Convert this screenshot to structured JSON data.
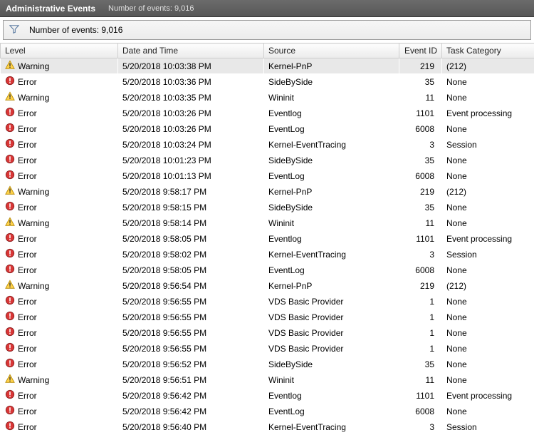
{
  "titlebar": {
    "title": "Administrative Events",
    "subtitle": "Number of events: 9,016"
  },
  "filterbar": {
    "count_label": "Number of events: 9,016"
  },
  "columns": {
    "level": "Level",
    "datetime": "Date and Time",
    "source": "Source",
    "event_id": "Event ID",
    "task_category": "Task Category"
  },
  "events": [
    {
      "level": "Warning",
      "icon": "warning",
      "datetime": "5/20/2018 10:03:38 PM",
      "source": "Kernel-PnP",
      "event_id": 219,
      "task_category": "(212)",
      "selected": true
    },
    {
      "level": "Error",
      "icon": "error",
      "datetime": "5/20/2018 10:03:36 PM",
      "source": "SideBySide",
      "event_id": 35,
      "task_category": "None"
    },
    {
      "level": "Warning",
      "icon": "warning",
      "datetime": "5/20/2018 10:03:35 PM",
      "source": "Wininit",
      "event_id": 11,
      "task_category": "None"
    },
    {
      "level": "Error",
      "icon": "error",
      "datetime": "5/20/2018 10:03:26 PM",
      "source": "Eventlog",
      "event_id": 1101,
      "task_category": "Event processing"
    },
    {
      "level": "Error",
      "icon": "error",
      "datetime": "5/20/2018 10:03:26 PM",
      "source": "EventLog",
      "event_id": 6008,
      "task_category": "None"
    },
    {
      "level": "Error",
      "icon": "error",
      "datetime": "5/20/2018 10:03:24 PM",
      "source": "Kernel-EventTracing",
      "event_id": 3,
      "task_category": "Session"
    },
    {
      "level": "Error",
      "icon": "error",
      "datetime": "5/20/2018 10:01:23 PM",
      "source": "SideBySide",
      "event_id": 35,
      "task_category": "None"
    },
    {
      "level": "Error",
      "icon": "error",
      "datetime": "5/20/2018 10:01:13 PM",
      "source": "EventLog",
      "event_id": 6008,
      "task_category": "None"
    },
    {
      "level": "Warning",
      "icon": "warning",
      "datetime": "5/20/2018 9:58:17 PM",
      "source": "Kernel-PnP",
      "event_id": 219,
      "task_category": "(212)"
    },
    {
      "level": "Error",
      "icon": "error",
      "datetime": "5/20/2018 9:58:15 PM",
      "source": "SideBySide",
      "event_id": 35,
      "task_category": "None"
    },
    {
      "level": "Warning",
      "icon": "warning",
      "datetime": "5/20/2018 9:58:14 PM",
      "source": "Wininit",
      "event_id": 11,
      "task_category": "None"
    },
    {
      "level": "Error",
      "icon": "error",
      "datetime": "5/20/2018 9:58:05 PM",
      "source": "Eventlog",
      "event_id": 1101,
      "task_category": "Event processing"
    },
    {
      "level": "Error",
      "icon": "error",
      "datetime": "5/20/2018 9:58:02 PM",
      "source": "Kernel-EventTracing",
      "event_id": 3,
      "task_category": "Session"
    },
    {
      "level": "Error",
      "icon": "error",
      "datetime": "5/20/2018 9:58:05 PM",
      "source": "EventLog",
      "event_id": 6008,
      "task_category": "None"
    },
    {
      "level": "Warning",
      "icon": "warning",
      "datetime": "5/20/2018 9:56:54 PM",
      "source": "Kernel-PnP",
      "event_id": 219,
      "task_category": "(212)"
    },
    {
      "level": "Error",
      "icon": "error",
      "datetime": "5/20/2018 9:56:55 PM",
      "source": "VDS Basic Provider",
      "event_id": 1,
      "task_category": "None"
    },
    {
      "level": "Error",
      "icon": "error",
      "datetime": "5/20/2018 9:56:55 PM",
      "source": "VDS Basic Provider",
      "event_id": 1,
      "task_category": "None"
    },
    {
      "level": "Error",
      "icon": "error",
      "datetime": "5/20/2018 9:56:55 PM",
      "source": "VDS Basic Provider",
      "event_id": 1,
      "task_category": "None"
    },
    {
      "level": "Error",
      "icon": "error",
      "datetime": "5/20/2018 9:56:55 PM",
      "source": "VDS Basic Provider",
      "event_id": 1,
      "task_category": "None"
    },
    {
      "level": "Error",
      "icon": "error",
      "datetime": "5/20/2018 9:56:52 PM",
      "source": "SideBySide",
      "event_id": 35,
      "task_category": "None"
    },
    {
      "level": "Warning",
      "icon": "warning",
      "datetime": "5/20/2018 9:56:51 PM",
      "source": "Wininit",
      "event_id": 11,
      "task_category": "None"
    },
    {
      "level": "Error",
      "icon": "error",
      "datetime": "5/20/2018 9:56:42 PM",
      "source": "Eventlog",
      "event_id": 1101,
      "task_category": "Event processing"
    },
    {
      "level": "Error",
      "icon": "error",
      "datetime": "5/20/2018 9:56:42 PM",
      "source": "EventLog",
      "event_id": 6008,
      "task_category": "None"
    },
    {
      "level": "Error",
      "icon": "error",
      "datetime": "5/20/2018 9:56:40 PM",
      "source": "Kernel-EventTracing",
      "event_id": 3,
      "task_category": "Session"
    }
  ]
}
